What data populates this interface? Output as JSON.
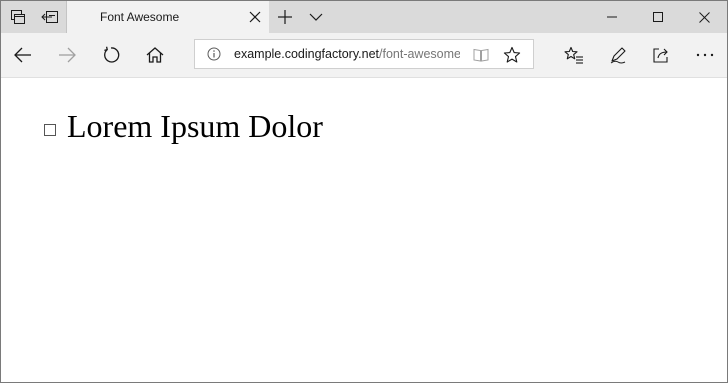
{
  "tab": {
    "title": "Font Awesome"
  },
  "address_bar": {
    "host": "example.codingfactory.net",
    "path": "/font-awesome"
  },
  "page": {
    "heading": "Lorem Ipsum Dolor"
  },
  "icons": {
    "tab_bar": [
      "tab-preview-icon",
      "set-tabs-aside-icon",
      "close-tab-icon",
      "new-tab-icon",
      "tab-list-chevron-icon"
    ],
    "window_controls": [
      "minimize-icon",
      "maximize-icon",
      "close-window-icon"
    ],
    "navigation": [
      "back-arrow-icon",
      "forward-arrow-icon",
      "refresh-icon",
      "home-icon"
    ],
    "address_bar": [
      "info-icon",
      "reading-view-icon",
      "favorite-star-icon"
    ],
    "toolbar": [
      "favorites-list-icon",
      "pen-icon",
      "share-icon",
      "more-icon"
    ]
  },
  "colors": {
    "tab_bar_background": "#dadada",
    "active_tab_background": "#f2f2f2",
    "content_background": "#ffffff"
  }
}
